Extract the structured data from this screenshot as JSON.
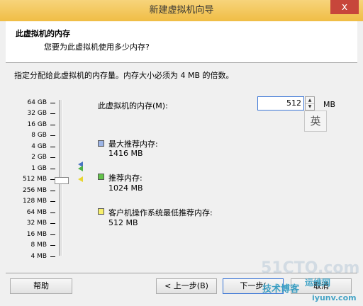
{
  "window": {
    "title": "新建虚拟机向导",
    "close": "x"
  },
  "header": {
    "title": "此虚拟机的内存",
    "subtitle": "您要为此虚拟机使用多少内存?"
  },
  "description": "指定分配给此虚拟机的内存量。内存大小必须为 4 MB 的倍数。",
  "scale": [
    "64 GB",
    "32 GB",
    "16 GB",
    "8 GB",
    "4 GB",
    "2 GB",
    "1 GB",
    "512 MB",
    "256 MB",
    "128 MB",
    "64 MB",
    "32 MB",
    "16 MB",
    "8 MB",
    "4 MB"
  ],
  "memory": {
    "label": "此虚拟机的内存(M):",
    "value": "512",
    "unit": "MB",
    "ime_glyph": "英"
  },
  "items": [
    {
      "label": "最大推荐内存:",
      "value": "1416 MB",
      "color": "#9db5e6"
    },
    {
      "label": "推荐内存:",
      "value": "1024 MB",
      "color": "#62c24a"
    },
    {
      "label": "客户机操作系统最低推荐内存:",
      "value": "512 MB",
      "color": "#f8f06c"
    }
  ],
  "buttons": {
    "help": "帮助",
    "prev": "< 上一步(B)",
    "next": "下一步(",
    "cancel": "取消"
  },
  "watermark": {
    "site": "51CTO.com",
    "brand": "技术博客",
    "ops": "运维网",
    "domain": "iyunv.com"
  }
}
